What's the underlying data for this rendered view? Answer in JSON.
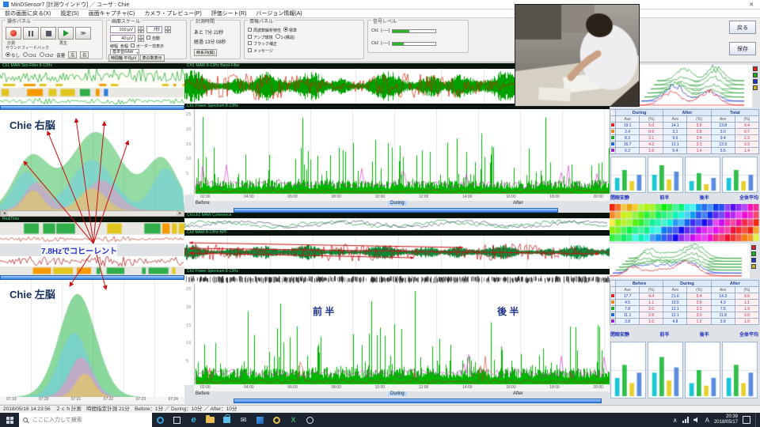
{
  "window": {
    "title": "MinDSensor7 [計測ウインドウ] ／ ユーザ : Chie",
    "close": "✕"
  },
  "menu": {
    "items": [
      "前の画面に戻る(X)",
      "設定(S)",
      "画面キャプチャ(C)",
      "カメラ・プレビュー(P)",
      "評価シート(R)",
      "バージョン情報(A)"
    ]
  },
  "toolbar": {
    "ops": {
      "title": "操作パネル",
      "record": "計測",
      "play": "再生",
      "sound_title": "サウンドフィードバック",
      "sound_opts": [
        "なし",
        "Ch1",
        "Ch2"
      ],
      "volume": "音量",
      "vol_l": "左",
      "vol_r": "右"
    },
    "scale": {
      "title": "画面スケール",
      "v1": "100 μV",
      "v2": "40 μV",
      "v3": "7秒",
      "auto": "自動",
      "lw": "線幅",
      "cw": "色幅",
      "border": "ボーダー非表示",
      "base": "基準音RAW",
      "b1": "時間軸 平均μV",
      "b2": "表の数表示",
      "b3": "時系列(縦)"
    },
    "time": {
      "title": "計測時間",
      "remain": "あと 7分 22秒",
      "elapsed": "経過 13分 08秒"
    },
    "info": {
      "title": "情報パネル",
      "rows": [
        "周波数解析特性",
        "アンプ環境",
        "ブラック補正",
        "メッセージ"
      ],
      "opt1": "標準",
      "opt2": "1-(構造)"
    },
    "signal": {
      "title": "信号レベル",
      "ch1": "Ch1",
      "ch2": "Ch2",
      "lv1": "[-----]",
      "lv2": "[-----]"
    },
    "back": "戻る",
    "save": "保存"
  },
  "left": {
    "h1": "Ch1 MAW Slot-Filter 8-13Hz",
    "h2": "RealTime",
    "right_brain": "Chie 右脳",
    "coherent": "7.8Hzでコヒーレント",
    "left_brain": "Chie 左脳",
    "ticks": [
      "07:19",
      "07:20",
      "07:21",
      "07:22",
      "07:23",
      "07:24"
    ]
  },
  "center": {
    "h1": "CH1 MAW 8-13Hz Band-Filter",
    "h2": "Ch1 Power Spectrum 8-13Hz",
    "h3": "Ch1ch2 MAW Coherence",
    "h4": "Ch2 MAW 8-13Hz BPF",
    "h5": "Ch2 Power Spectrum 8-13Hz",
    "before": "Before",
    "during": "During",
    "after": "After",
    "first_half": "前 半",
    "second_half": "後 半",
    "spec_axis": [
      "25",
      "20",
      "15",
      "10",
      "5"
    ],
    "ticks1": [
      "02:00",
      "04:00",
      "06:00",
      "08:00",
      "10:00",
      "12:00",
      "14:00",
      "16:00",
      "18:00",
      "20:00"
    ],
    "ticks2": [
      "02:00",
      "04:00",
      "06:00",
      "08:00",
      "10:00",
      "12:00",
      "14:00",
      "16:00",
      "18:00",
      "20:00"
    ]
  },
  "right": {
    "legend_colors": [
      "#dd2222",
      "#22aa22",
      "#2233cc",
      "#ccaa22"
    ],
    "table_top": {
      "groups": [
        "During",
        "After",
        "Total"
      ],
      "sub": [
        "Ave",
        "(%)"
      ],
      "row_colors": [
        "#d22",
        "#e82",
        "#2a2",
        "#26c",
        "#92c"
      ],
      "rows": [
        [
          "19.1",
          "5.0",
          "14.1",
          "3.5",
          "13.8",
          "3.4"
        ],
        [
          "2.4",
          "0.6",
          "3.1",
          "0.8",
          "3.0",
          "0.7"
        ],
        [
          "8.3",
          "2.1",
          "9.6",
          "2.4",
          "9.4",
          "2.3"
        ],
        [
          "16.7",
          "4.2",
          "13.1",
          "3.3",
          "13.3",
          "3.3"
        ],
        [
          "6.2",
          "1.6",
          "5.4",
          "1.4",
          "5.5",
          "1.4"
        ]
      ]
    },
    "bars_top": {
      "labels": [
        "閉眼安静",
        "前半",
        "後半",
        "全体平均"
      ],
      "ymax": 20,
      "charts": [
        [
          8,
          13,
          6,
          10
        ],
        [
          10,
          16,
          7,
          12
        ],
        [
          6,
          11,
          4,
          8
        ],
        [
          8,
          13,
          6,
          10
        ]
      ]
    },
    "table_bottom": {
      "groups": [
        "Before",
        "During",
        "After"
      ],
      "sub": [
        "Ave",
        "(%)"
      ],
      "row_colors": [
        "#d22",
        "#e82",
        "#2a2",
        "#26c",
        "#92c"
      ],
      "rows": [
        [
          "17.7",
          "4.4",
          "21.6",
          "5.4",
          "14.3",
          "3.6"
        ],
        [
          "4.5",
          "1.1",
          "10.5",
          "2.6",
          "4.3",
          "1.1"
        ],
        [
          "7.8",
          "2.0",
          "13.1",
          "3.3",
          "7.5",
          "1.9"
        ],
        [
          "11.1",
          "2.8",
          "12.1",
          "3.0",
          "11.8",
          "3.0"
        ],
        [
          "3.8",
          "1.0",
          "4.8",
          "1.2",
          "3.9",
          "1.0"
        ]
      ]
    },
    "bars_bottom": {
      "labels": [
        "閉眼安静",
        "前半",
        "後半",
        "全体平均"
      ],
      "ymax": 20,
      "charts": [
        [
          7,
          12,
          5,
          9
        ],
        [
          9,
          15,
          6,
          11
        ],
        [
          5,
          10,
          4,
          7
        ],
        [
          7,
          12,
          5,
          9
        ]
      ]
    }
  },
  "status": {
    "text": "2018/05/16 14:23:56　２ｃｈ計測　時間指定計測 21分　Before：1分 ／ During：10分 ／ After：10分"
  },
  "taskbar": {
    "search": "ここに入力して検索",
    "time": "20:39",
    "date": "2018/05/17",
    "ime": "A"
  }
}
